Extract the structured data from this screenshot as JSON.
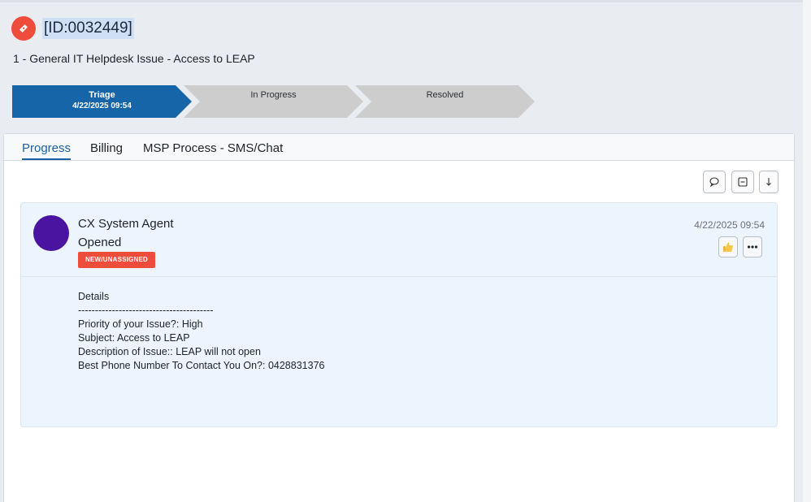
{
  "ticket": {
    "id": "[ID:0032449]",
    "title": "1 - General IT Helpdesk Issue - Access to LEAP",
    "icon": "ticket-icon",
    "icon_color": "#ef4d3c"
  },
  "stages": [
    {
      "name": "Triage",
      "date": "4/22/2025 09:54",
      "active": true
    },
    {
      "name": "In Progress",
      "date": "",
      "active": false
    },
    {
      "name": "Resolved",
      "date": "",
      "active": false
    }
  ],
  "tabs": [
    {
      "label": "Progress",
      "active": true
    },
    {
      "label": "Billing",
      "active": false
    },
    {
      "label": "MSP Process - SMS/Chat",
      "active": false
    }
  ],
  "toolbar": {
    "icons": [
      "comment-icon",
      "collapse-icon",
      "download-arrow-icon"
    ]
  },
  "entry": {
    "author": "CX System Agent",
    "action": "Opened",
    "status_badge": "NEW/UNASSIGNED",
    "timestamp": "4/22/2025 09:54",
    "avatar_color": "#4a13a0",
    "details": [
      "Details",
      "----------------------------------------",
      "Priority of your Issue?: High",
      "Subject: Access to LEAP",
      "Description of Issue:: LEAP will not open",
      "Best Phone Number To Contact You On?: 0428831376"
    ]
  },
  "colors": {
    "accent": "#1565a8",
    "badge": "#ef4d3c",
    "card_bg": "#ecf4fd"
  }
}
